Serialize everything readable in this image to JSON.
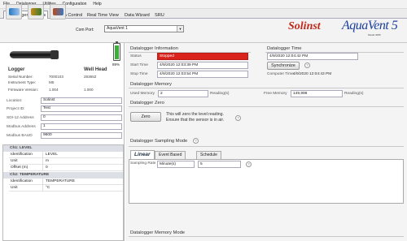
{
  "menu": [
    "File",
    "Datalogger",
    "Utilities",
    "Configuration",
    "Help"
  ],
  "tabs": [
    "Datalogger Settings",
    "Data Control",
    "Real Time View",
    "Data Wizard",
    "SRU"
  ],
  "toolbar": {
    "com_port_label": "Com Port:",
    "com_port_value": "AquaVent 1"
  },
  "brand": {
    "logo": "Solinst",
    "product": "AquaVent 5",
    "model": "Model 3005"
  },
  "battery": {
    "level_percent": 89,
    "label": "89%"
  },
  "logger": {
    "col1_title": "Logger",
    "col2_title": "Well Head",
    "serial_label": "Serial Number:",
    "serial_logger": "7000103",
    "serial_wellhead": "283652",
    "instrument_label": "Instrument Type:",
    "instrument_logger": "M5",
    "firmware_label": "Firmware Version:",
    "firmware_logger": "1.004",
    "firmware_wellhead": "1.000"
  },
  "fields": {
    "location_label": "Location:",
    "location": "Solinst",
    "project_label": "Project ID:",
    "project": "Test",
    "sdi_label": "SDI-12 Address",
    "sdi": "0",
    "modbus_label": "Modbus Address",
    "modbus": "1",
    "baud_label": "Modbus BAUD",
    "baud": "9600"
  },
  "channels": [
    {
      "header": "Ch1: LEVEL",
      "rows": [
        [
          "Identification",
          "LEVEL"
        ],
        [
          "Unit",
          "m"
        ],
        [
          "Offset (m)",
          "0"
        ]
      ]
    },
    {
      "header": "Ch2: TEMPERATURE",
      "rows": [
        [
          "Identification",
          "TEMPERATURE"
        ],
        [
          "Unit",
          "°C"
        ]
      ]
    }
  ],
  "info": {
    "title": "Datalogger Information",
    "status_label": "Status",
    "status": "Stopped",
    "start_label": "Start Time",
    "start": "4/9/2020 12:03:39 PM",
    "stop_label": "Stop Time",
    "stop": "4/9/2020 12:03:54 PM"
  },
  "time": {
    "title": "Datalogger Time",
    "datalogger": "4/9/2020 12:04:42 PM",
    "sync_label": "Synchronize",
    "computer_label": "Computer Time:",
    "computer": "4/9/2020 12:04:43 PM"
  },
  "memory": {
    "title": "Datalogger Memory",
    "used_label": "Used Memory",
    "used": "2",
    "readings": "Reading(s)",
    "free_label": "Free Memory",
    "free": "149,998"
  },
  "zero": {
    "title": "Datalogger Zero",
    "button": "Zero",
    "text1": "This will zero the level reading.",
    "text2": "Ensure that the sensor is in air."
  },
  "sampling": {
    "title": "Datalogger Sampling Mode",
    "tabs": [
      "Linear",
      "Event Based",
      "Schedule"
    ],
    "rate_label": "Sampling Rate",
    "rate_unit": "Minute(s)",
    "rate_value": "5"
  },
  "memory_mode": {
    "title": "Datalogger Memory Mode"
  },
  "colors": {
    "status_bg": "#d9231c",
    "accent": "#1b3f9e",
    "logo": "#c02a1a"
  }
}
